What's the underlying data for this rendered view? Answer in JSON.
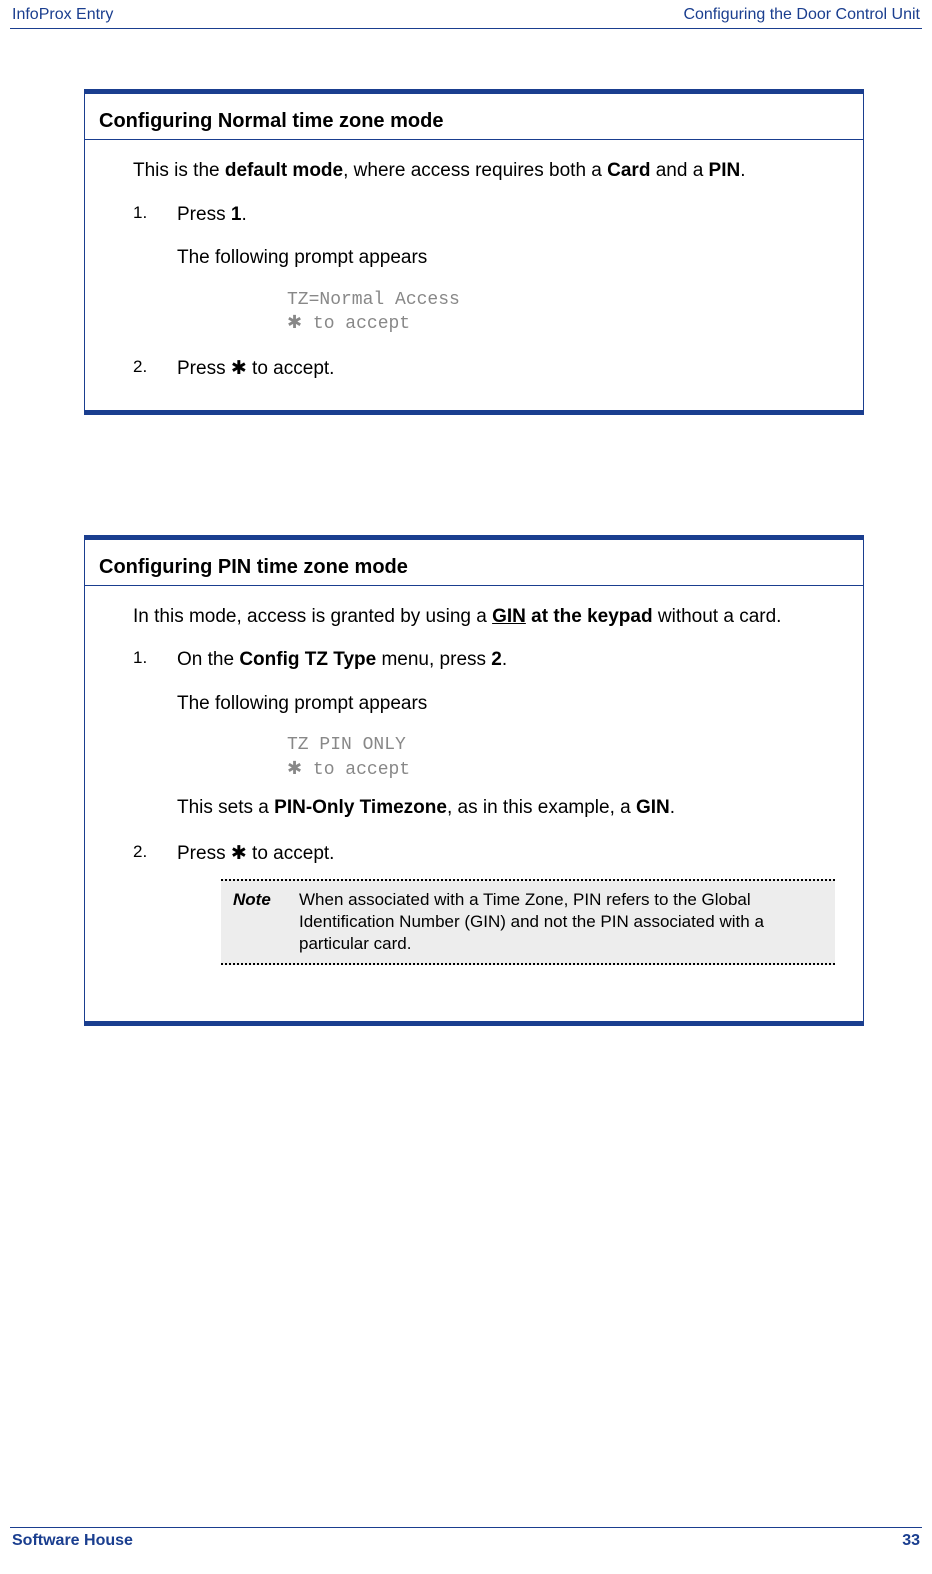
{
  "header": {
    "left": "InfoProx Entry",
    "right": "Configuring the Door Control Unit"
  },
  "section1": {
    "title": "Configuring Normal time zone mode",
    "intro_pre": "This is the ",
    "intro_b1": "default mode",
    "intro_mid": ", where access requires both a ",
    "intro_b2": "Card",
    "intro_and": " and a ",
    "intro_b3": "PIN",
    "intro_end": ".",
    "step1_num": "1.",
    "step1_pre": "Press ",
    "step1_b": "1",
    "step1_end": ".",
    "step1_note": "The following prompt appears",
    "prompt1_line1": "TZ=Normal Access",
    "prompt1_line2": " to accept",
    "step2_num": "2.",
    "step2_pre": "Press ",
    "step2_post": " to accept."
  },
  "section2": {
    "title": "Configuring PIN time zone mode",
    "intro_pre": "In this mode, access is granted by using a ",
    "intro_ub": "GIN",
    "intro_b": " at the keypad",
    "intro_end": " without a card.",
    "step1_num": "1.",
    "step1_pre": "On the ",
    "step1_b1": "Config TZ Type",
    "step1_mid": " menu, press ",
    "step1_b2": "2",
    "step1_end": ".",
    "step1_note": "The following prompt appears",
    "prompt1_line1": "TZ PIN ONLY",
    "prompt1_line2": " to accept",
    "sets_pre": "This sets a ",
    "sets_b1": "PIN-Only Timezone",
    "sets_mid": ", as in this example, a ",
    "sets_b2": "GIN",
    "sets_end": ".",
    "step2_num": "2.",
    "step2_pre": "Press ",
    "step2_post": " to accept.",
    "note_label": "Note",
    "note_text": "When associated with a Time Zone, PIN refers to the Global Identification Number (GIN) and not the PIN associated with a particular card."
  },
  "footer": {
    "left": "Software House",
    "right": "33"
  },
  "icons": {
    "star": "✱"
  }
}
